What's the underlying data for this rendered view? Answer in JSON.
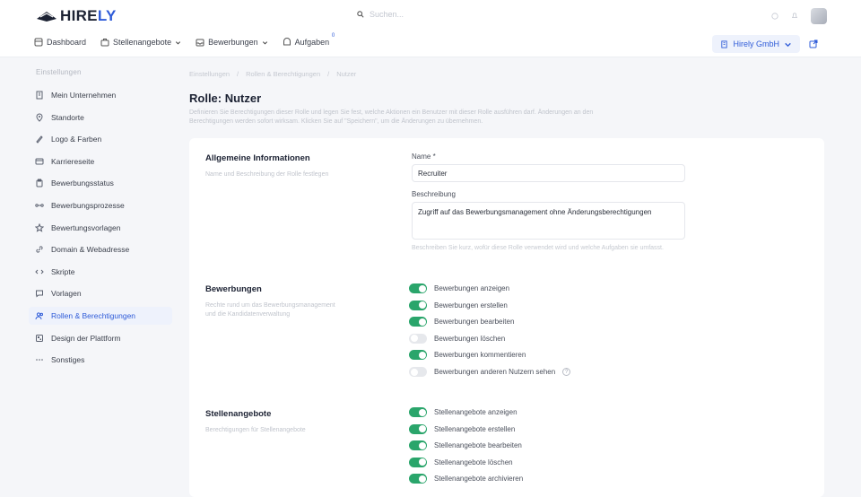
{
  "brand": {
    "name_main": "HIRE",
    "name_accent": "LY"
  },
  "search": {
    "placeholder": "Suchen..."
  },
  "nav": {
    "items": [
      {
        "label": "Dashboard",
        "icon": "dashboard-icon"
      },
      {
        "label": "Stellenangebote",
        "icon": "briefcase-icon",
        "dropdown": true
      },
      {
        "label": "Bewerbungen",
        "icon": "inbox-icon",
        "dropdown": true
      },
      {
        "label": "Aufgaben",
        "icon": "tasks-icon",
        "badge": "0"
      }
    ],
    "company": "Hirely GmbH"
  },
  "sidebar": {
    "heading": "Einstellungen",
    "items": [
      {
        "label": "Mein Unternehmen",
        "icon": "building-icon"
      },
      {
        "label": "Standorte",
        "icon": "location-pin-icon"
      },
      {
        "label": "Logo & Farben",
        "icon": "brush-icon"
      },
      {
        "label": "Karriereseite",
        "icon": "layout-icon"
      },
      {
        "label": "Bewerbungsstatus",
        "icon": "clipboard-icon"
      },
      {
        "label": "Bewerbungsprozesse",
        "icon": "workflow-icon"
      },
      {
        "label": "Bewertungsvorlagen",
        "icon": "star-icon"
      },
      {
        "label": "Domain & Webadresse",
        "icon": "link-icon"
      },
      {
        "label": "Skripte",
        "icon": "code-icon"
      },
      {
        "label": "Vorlagen",
        "icon": "chat-icon"
      },
      {
        "label": "Rollen & Berechtigungen",
        "icon": "users-icon",
        "active": true
      },
      {
        "label": "Design der Plattform",
        "icon": "palette-icon"
      },
      {
        "label": "Sonstiges",
        "icon": "more-icon"
      }
    ]
  },
  "breadcrumb": [
    "Einstellungen",
    "/",
    "Rollen & Berechtigungen",
    "/",
    "Nutzer"
  ],
  "page": {
    "title": "Rolle: Nutzer",
    "description": "Definieren Sie Berechtigungen dieser Rolle und legen Sie fest, welche Aktionen ein Benutzer mit dieser Rolle ausführen darf. Änderungen an den Berechtigungen werden sofort wirksam. Klicken Sie auf \"Speichern\", um die Änderungen zu übernehmen."
  },
  "general": {
    "title": "Allgemeine Informationen",
    "description": "Name und Beschreibung der Rolle festlegen",
    "name_label": "Name *",
    "name_value": "Recruiter",
    "desc_label": "Beschreibung",
    "desc_value": "Zugriff auf das Bewerbungsmanagement ohne Änderungsberechtigungen",
    "hint": "Beschreiben Sie kurz, wofür diese Rolle verwendet wird und welche Aufgaben sie umfasst."
  },
  "applications": {
    "title": "Bewerbungen",
    "description": "Rechte rund um das Bewerbungsmanagement und die Kandidatenverwaltung",
    "permissions": [
      {
        "label": "Bewerbungen anzeigen",
        "on": true
      },
      {
        "label": "Bewerbungen erstellen",
        "on": true
      },
      {
        "label": "Bewerbungen bearbeiten",
        "on": true
      },
      {
        "label": "Bewerbungen löschen",
        "on": false
      },
      {
        "label": "Bewerbungen kommentieren",
        "on": true
      },
      {
        "label": "Bewerbungen anderen Nutzern sehen",
        "on": false,
        "help": true
      }
    ]
  },
  "jobs": {
    "title": "Stellenangebote",
    "description": "Berechtigungen für Stellenangebote",
    "permissions": [
      {
        "label": "Stellenangebote anzeigen",
        "on": true
      },
      {
        "label": "Stellenangebote erstellen",
        "on": true
      },
      {
        "label": "Stellenangebote bearbeiten",
        "on": true
      },
      {
        "label": "Stellenangebote löschen",
        "on": true
      },
      {
        "label": "Stellenangebote archivieren",
        "on": true
      }
    ]
  },
  "colors": {
    "accent": "#2e5bd8",
    "toggle_on": "#2aa56b",
    "toggle_off": "#e6e8ec"
  }
}
